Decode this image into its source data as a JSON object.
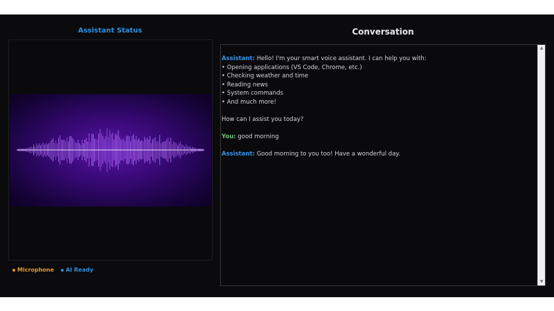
{
  "status": {
    "title": "Assistant Status",
    "indicators": [
      {
        "label": "Microphone",
        "color": "#e89a2a"
      },
      {
        "label": "AI Ready",
        "color": "#2f8fe0"
      }
    ]
  },
  "conversation": {
    "title": "Conversation",
    "messages": [
      {
        "role": "Assistant:",
        "text": "Hello! I'm your smart voice assistant. I can help you with:"
      },
      {
        "bullets": [
          "• Opening applications (VS Code, Chrome, etc.)",
          "• Checking weather and time",
          "• Reading news",
          "• System commands",
          "• And much more!"
        ]
      },
      {
        "text": "How can I assist you today?"
      },
      {
        "role": "You:",
        "text": "good morning"
      },
      {
        "role": "Assistant:",
        "text": "Good morning to you too! Have a wonderful day."
      }
    ]
  },
  "icons": {
    "scroll_up": "triangle-up",
    "scroll_down": "triangle-down"
  }
}
